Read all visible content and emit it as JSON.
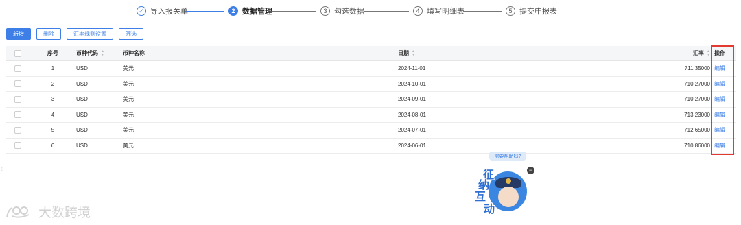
{
  "steps": [
    {
      "num": "✓",
      "label": "导入报关单",
      "state": "done"
    },
    {
      "num": "2",
      "label": "数据管理",
      "state": "active"
    },
    {
      "num": "3",
      "label": "勾选数据",
      "state": "todo"
    },
    {
      "num": "4",
      "label": "填写明细表",
      "state": "todo"
    },
    {
      "num": "5",
      "label": "提交申报表",
      "state": "todo"
    }
  ],
  "toolbar": {
    "add_label": "新增",
    "delete_label": "删除",
    "rule_label": "汇率规则设置",
    "filter_label": "筛选"
  },
  "table": {
    "headers": {
      "seq": "序号",
      "code": "币种代码",
      "name": "币种名称",
      "date": "日期",
      "rate": "汇率",
      "op": "操作"
    },
    "rows": [
      {
        "seq": "1",
        "code": "USD",
        "name": "美元",
        "date": "2024-11-01",
        "rate": "711.35000",
        "op": "编辑"
      },
      {
        "seq": "2",
        "code": "USD",
        "name": "美元",
        "date": "2024-10-01",
        "rate": "710.27000",
        "op": "编辑"
      },
      {
        "seq": "3",
        "code": "USD",
        "name": "美元",
        "date": "2024-09-01",
        "rate": "710.27000",
        "op": "编辑"
      },
      {
        "seq": "4",
        "code": "USD",
        "name": "美元",
        "date": "2024-08-01",
        "rate": "713.23000",
        "op": "编辑"
      },
      {
        "seq": "5",
        "code": "USD",
        "name": "美元",
        "date": "2024-07-01",
        "rate": "712.65000",
        "op": "编辑"
      },
      {
        "seq": "6",
        "code": "USD",
        "name": "美元",
        "date": "2024-06-01",
        "rate": "710.86000",
        "op": "编辑"
      }
    ]
  },
  "assistant": {
    "bubble": "需要帮助吗?",
    "chars": [
      "征",
      "纳",
      "互",
      "动"
    ]
  },
  "watermark": {
    "text": "大数跨境"
  },
  "colors": {
    "accent": "#3d7fe6",
    "highlight": "#e23a2e"
  }
}
